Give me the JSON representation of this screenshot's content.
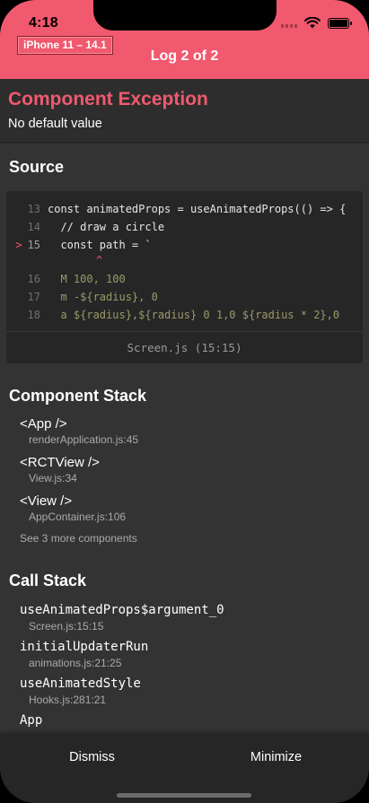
{
  "status_bar": {
    "time": "4:18"
  },
  "device_badge": "iPhone 11 – 14.1",
  "log_title": "Log 2 of 2",
  "exception": {
    "title": "Component Exception",
    "message": "No default value"
  },
  "source": {
    "title": "Source",
    "lines": [
      {
        "num": "13",
        "marker": "",
        "text": "const animatedProps = useAnimatedProps(() => {"
      },
      {
        "num": "14",
        "marker": "",
        "text": "  // draw a circle"
      },
      {
        "num": "15",
        "marker": ">",
        "text": "  const path = `"
      },
      {
        "num": "",
        "marker": "",
        "text": "^"
      },
      {
        "num": "16",
        "marker": "",
        "text": "  M 100, 100"
      },
      {
        "num": "17",
        "marker": "",
        "text": "  m -${radius}, 0"
      },
      {
        "num": "18",
        "marker": "",
        "text": "  a ${radius},${radius} 0 1,0 ${radius * 2},0"
      }
    ],
    "file": "Screen.js (15:15)"
  },
  "component_stack": {
    "title": "Component Stack",
    "items": [
      {
        "name": "<App />",
        "file": "renderApplication.js:45"
      },
      {
        "name": "<RCTView />",
        "file": "View.js:34"
      },
      {
        "name": "<View />",
        "file": "AppContainer.js:106"
      }
    ],
    "see_more": "See 3 more components"
  },
  "call_stack": {
    "title": "Call Stack",
    "items": [
      {
        "fn": "useAnimatedProps$argument_0",
        "file": "Screen.js:15:15"
      },
      {
        "fn": "initialUpdaterRun",
        "file": "animations.js:21:25"
      },
      {
        "fn": "useAnimatedStyle",
        "file": "Hooks.js:281:21"
      },
      {
        "fn": "App",
        "file": ""
      }
    ]
  },
  "footer": {
    "dismiss": "Dismiss",
    "minimize": "Minimize"
  },
  "colors": {
    "accent": "#f0596e",
    "background": "#333333",
    "code_bg": "#262626"
  }
}
